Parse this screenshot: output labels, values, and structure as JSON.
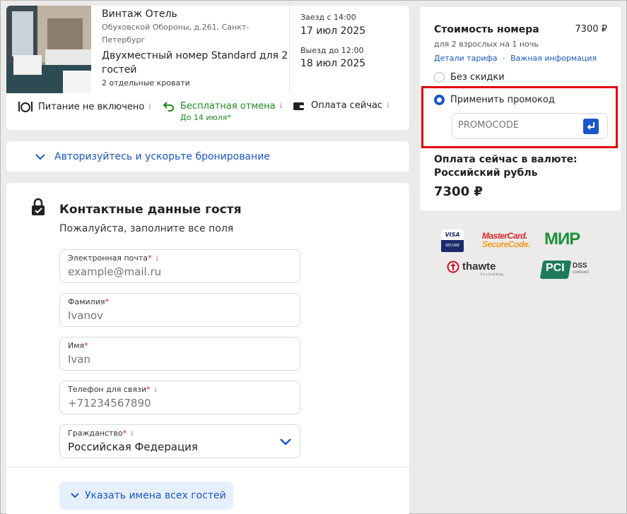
{
  "hotel": {
    "name": "Винтаж Отель",
    "address_line1": "Обуховской Обороны, д.261, Санкт-",
    "address_line2": "Петербург",
    "room_line1": "Двухместный номер Standard для 2",
    "room_line2": "гостей",
    "beds": "2 отдельные кровати",
    "checkin_label": "Заезд с 14:00",
    "checkin_date": "17 июл 2025",
    "checkout_label": "Выезд до 12:00",
    "checkout_date": "18 июл 2025"
  },
  "features": {
    "meal": "Питание не включено",
    "cancel": "Бесплатная отмена",
    "cancel_sub": "До 14 июля*",
    "payment": "Оплата сейчас",
    "info_glyph": "i"
  },
  "auth": {
    "label": "Авторизуйтесь и ускорьте бронирование"
  },
  "contact": {
    "title": "Контактные данные гостя",
    "subtitle": "Пожалуйста, заполните все поля",
    "fields": [
      {
        "label": "Электронная почта",
        "placeholder": "example@mail.ru"
      },
      {
        "label": "Фамилия",
        "placeholder": "Ivanov"
      },
      {
        "label": "Имя",
        "placeholder": "Ivan"
      },
      {
        "label": "Телефон для связи",
        "placeholder": "+71234567890"
      },
      {
        "label": "Гражданство",
        "value": "Российская Федерация"
      }
    ],
    "required_mark": "*",
    "guests_button": "Указать имена всех гостей"
  },
  "price": {
    "title": "Стоимость номера",
    "amount": "7300 ₽",
    "subtitle": "для 2 взрослых на 1 ночь",
    "link_tariff": "Детали тарифа",
    "separator": "·",
    "link_info": "Важная информация",
    "no_discount": "Без скидки",
    "apply_promo": "Применить промокод",
    "promo_placeholder": "PROMOCODE",
    "pay_currency_line1": "Оплата сейчас в валюте:",
    "pay_currency_line2": "Российский рубль",
    "total": "7300 ₽"
  },
  "logos": {
    "visa": "VISA",
    "visa_sub": "SECURE",
    "mastercard1": "MasterCard.",
    "mastercard2": "SecureCode.",
    "mir": "МИР",
    "thawte": "thawte",
    "thawte_sub": "it's a trust thing",
    "pci": "PCI",
    "dss": "DSS",
    "dss_sub": "COMPLIANT"
  },
  "colors": {
    "accent_blue": "#1a56c8",
    "green": "#1c8a1c",
    "highlight_red": "#e00000",
    "mir_green": "#1e8f3e",
    "mastercard_red": "#d8252c",
    "mastercard_orange": "#f59b1f"
  }
}
